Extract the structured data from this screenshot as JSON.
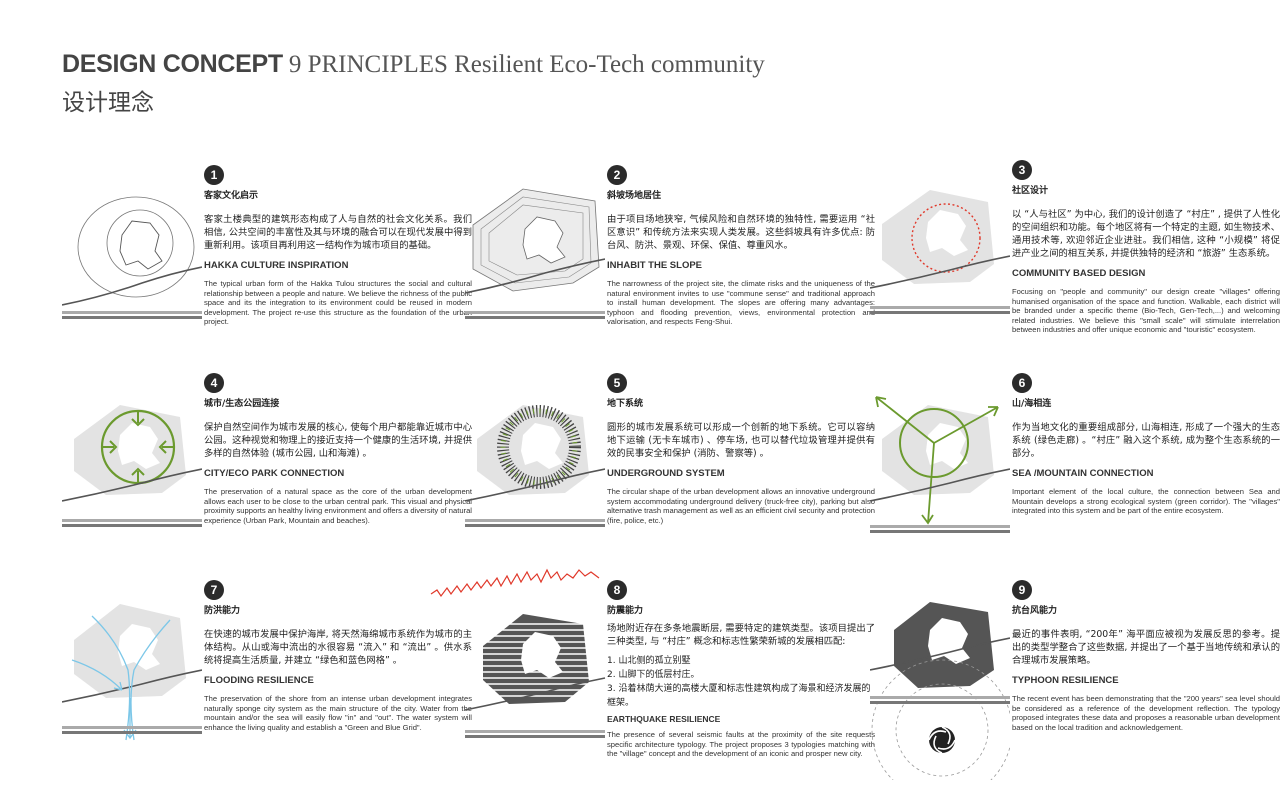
{
  "header": {
    "main": "DESIGN CONCEPT",
    "sub": "9 PRINCIPLES Resilient Eco-Tech community",
    "cn": "设计理念"
  },
  "colors": {
    "accent_green": "#6b9a2e",
    "accent_red": "#e0382a",
    "accent_blue": "#7cc7e8",
    "shape_gray": "#e3e3e3"
  },
  "principles": [
    {
      "num": "1",
      "cn_title": "客家文化启示",
      "cn_body": "客家土楼典型的建筑形态构成了人与自然的社会文化关系。我们相信, 公共空间的丰富性及其与环境的融合可以在现代发展中得到重新利用。该项目再利用这一结构作为城市项目的基础。",
      "en_title": "HAKKA CULTURE INSPIRATION",
      "en_body": "The typical urban form of the Hakka Tulou structures the social and cultural relationship between a people and nature. We believe the richness of the public space and its the integration to its environment could be reused in modern development. The project re-use this structure as the foundation of the urban project."
    },
    {
      "num": "2",
      "cn_title": "斜坡场地居住",
      "cn_body": "由于项目场地狭窄, 气候风险和自然环境的独特性, 需要运用 “社区意识” 和传统方法来实现人类发展。这些斜坡具有许多优点: 防台风、防洪、景观、环保、保值、尊重风水。",
      "en_title": "INHABIT THE SLOPE",
      "en_body": "The narrowness of the project site, the climate risks and the uniqueness of the natural environment invites to use \"commune sense\" and traditional approach to install human development. The slopes are offering many advantages: typhoon and flooding prevention, views, environmental protection and valorisation, and respects Feng-Shui."
    },
    {
      "num": "3",
      "cn_title": "社区设计",
      "cn_body": "以 “人与社区” 为中心, 我们的设计创造了 “村庄” , 提供了人性化的空间组织和功能。每个地区将有一个特定的主题, 如生物技术、通用技术等, 欢迎邻近企业进驻。我们相信, 这种 “小规模” 将促进产业之间的相互关系, 并提供独特的经济和 “旅游” 生态系统。",
      "en_title": "COMMUNITY BASED DESIGN",
      "en_body": "Focusing on \"people and community\" our design create \"villages\" offering humanised organisation of the space and function. Walkable, each district will be branded under a specific theme (Bio-Tech, Gen-Tech,...) and welcoming related industries. We believe this \"small scale\" will stimulate interrelation between industries and offer unique economic and \"touristic\" ecosystem."
    },
    {
      "num": "4",
      "cn_title": "城市/生态公园连接",
      "cn_body": "保护自然空间作为城市发展的核心, 使每个用户都能靠近城市中心公园。这种视觉和物理上的接近支持一个健康的生活环境, 并提供多样的自然体验 (城市公园, 山和海滩) 。",
      "en_title": "CITY/ECO PARK CONNECTION",
      "en_body": "The preservation of a natural space as the core of the urban development allows each user to be close to the urban central park. This visual and physical proximity supports an healthy living environment and offers a diversity of natural experience (Urban Park, Mountain and beaches)."
    },
    {
      "num": "5",
      "cn_title": "地下系统",
      "cn_body": "圆形的城市发展系统可以形成一个创新的地下系统。它可以容纳地下运输 (无卡车城市) 、停车场, 也可以替代垃圾管理并提供有效的民事安全和保护 (消防、警察等) 。",
      "en_title": "UNDERGROUND SYSTEM",
      "en_body": "The circular shape of the urban development allows an innovative underground system accommodating underground delivery (truck-free city), parking but also alternative trash management as well as an efficient civil security and protection (fire, police, etc.)"
    },
    {
      "num": "6",
      "cn_title": "山/海相连",
      "cn_body": "作为当地文化的重要组成部分, 山海相连, 形成了一个强大的生态系统 (绿色走廊) 。“村庄” 融入这个系统, 成为整个生态系统的一部分。",
      "en_title": "SEA /MOUNTAIN CONNECTION",
      "en_body": "Important element of the local culture, the connection between Sea and Mountain develops a strong ecological system (green corridor). The \"villages\" integrated into this system and be part of the entire ecosystem."
    },
    {
      "num": "7",
      "cn_title": "防洪能力",
      "cn_body": "在快速的城市发展中保护海岸, 将天然海绵城市系统作为城市的主体结构。从山或海中流出的水很容易 “流入” 和 “流出” 。供水系统将提高生活质量, 并建立 “绿色和蓝色网格” 。",
      "en_title": "FLOODING RESILIENCE",
      "en_body": "The preservation of the shore from an intense urban development integrates naturally sponge city system as the main structure of the city. Water from the mountain and/or the sea will easily flow \"in\" and \"out\". The water system will enhance the living quality and establish a \"Green and Blue Grid\"."
    },
    {
      "num": "8",
      "cn_title": "防震能力",
      "cn_body": "场地附近存在多条地震断层, 需要特定的建筑类型。该项目提出了三种类型, 与 “村庄” 概念和标志性繁荣新城的发展相匹配:",
      "list": [
        "1. 山北侧的孤立别墅",
        "2. 山脚下的低层村庄。",
        "3. 沿着林荫大道的高楼大厦和标志性建筑构成了海景和经济发展的框架。"
      ],
      "en_title": "EARTHQUAKE RESILIENCE",
      "en_body": "The presence of several seismic faults at the proximity of the site requests specific architecture typology. The project proposes 3 typologies matching with the \"village\" concept and the development of an iconic and prosper new city."
    },
    {
      "num": "9",
      "cn_title": "抗台风能力",
      "cn_body": "最近的事件表明, “200年” 海平面应被视为发展反思的参考。提出的类型学整合了这些数据, 并提出了一个基于当地传统和承认的合理城市发展策略。",
      "en_title": "TYPHOON RESILIENCE",
      "en_body": "The recent event has been demonstrating that the \"200 years\" sea level should be considered as a reference of the development reflection. The typology proposed integrates these data and proposes a reasonable urban development based on the local tradition and acknowledgement."
    }
  ]
}
